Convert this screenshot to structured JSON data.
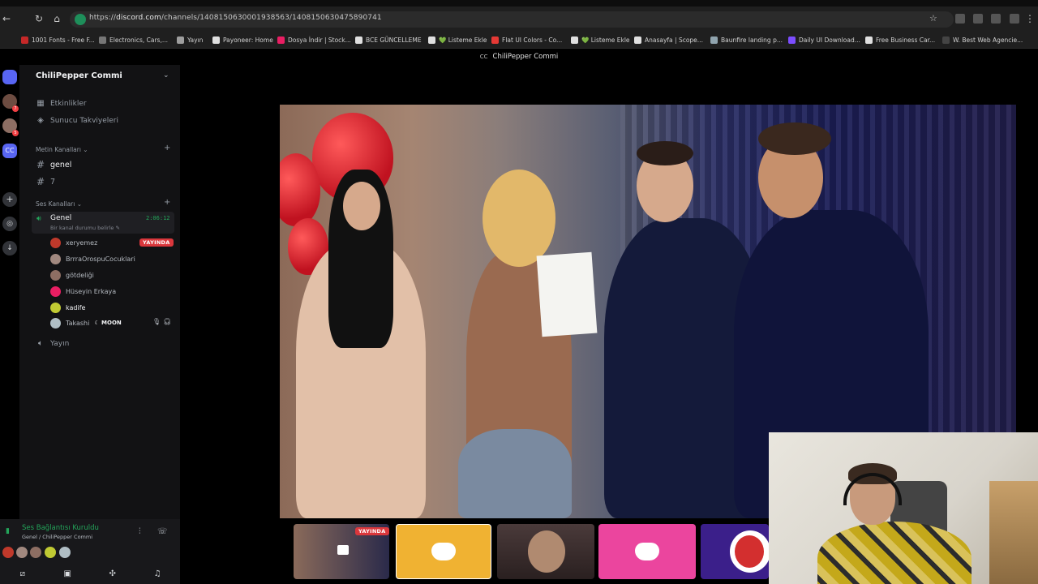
{
  "browser": {
    "url_prefix": "https://",
    "url_host": "discord.com",
    "url_path": "/channels/1408150630001938563/1408150630475890741",
    "bookmarks": [
      {
        "label": "1001 Fonts - Free F...",
        "color": "#c62828"
      },
      {
        "label": "Electronics, Cars,...",
        "color": "#777777"
      },
      {
        "label": "Yayın",
        "color": "#9e9e9e"
      },
      {
        "label": "Payoneer: Home",
        "color": "#e0e0e0"
      },
      {
        "label": "Dosya İndir | Stock...",
        "color": "#e91e63"
      },
      {
        "label": "BCE GÜNCELLEME",
        "color": "#e0e0e0"
      },
      {
        "label": "💚 Listeme Ekle",
        "color": "#e0e0e0"
      },
      {
        "label": "Flat UI Colors - Co...",
        "color": "#e53935"
      },
      {
        "label": "💚 Listeme Ekle",
        "color": "#e0e0e0"
      },
      {
        "label": "Anasayfa | Scope...",
        "color": "#e0e0e0"
      },
      {
        "label": "Baunfire landing p...",
        "color": "#90a4ae"
      },
      {
        "label": "Daily UI Download...",
        "color": "#7c4dff"
      },
      {
        "label": "Free Business Car...",
        "color": "#e0e0e0"
      },
      {
        "label": "W. Best Web Agencie...",
        "color": "#444444"
      }
    ]
  },
  "window": {
    "title": "ChiliPepper Commi",
    "title_prefix": "CC"
  },
  "server": {
    "name": "ChiliPepper Commi",
    "top_items": [
      {
        "label": "Etkinlikler",
        "icon": "calendar-icon"
      },
      {
        "label": "Sunucu Takviyeleri",
        "icon": "boost-icon"
      }
    ],
    "text_category": "Metin Kanalları",
    "text_channels": [
      "genel",
      "7"
    ],
    "voice_category": "Ses Kanalları",
    "active_voice": {
      "name": "Genel",
      "status": "Bir kanal durumu belirle",
      "time": "2:06:12"
    },
    "members": [
      {
        "name": "xeryemez",
        "live": "YAYINDA",
        "color": "#c0392b"
      },
      {
        "name": "BrrraOrospuCocuklari",
        "color": "#a1887f"
      },
      {
        "name": "götdeliği",
        "color": "#8d6e63"
      },
      {
        "name": "Hüseyin Erkaya",
        "color": "#e91e63"
      },
      {
        "name": "kadife",
        "color": "#c0ca33"
      },
      {
        "name": "Takashi",
        "tag": "MOON",
        "color": "#b0bec5"
      }
    ],
    "other_voice": "Yayın"
  },
  "panel": {
    "connection_title": "Ses Bağlantısı Kuruldu",
    "connection_sub": "Genel / ChiliPepper Commi"
  },
  "stream_tiles": {
    "live_label": "YAYINDA",
    "colors": {
      "discord_yellow": "#f0b232",
      "discord_pink": "#eb459e",
      "purple": "#3b1f8a"
    }
  },
  "accent": {
    "green": "#23a55a",
    "red": "#da373c",
    "blurple": "#5865f2"
  }
}
